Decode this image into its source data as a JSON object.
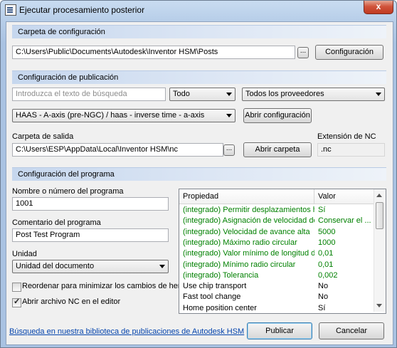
{
  "window": {
    "title": "Ejecutar procesamiento posterior",
    "close_glyph": "x"
  },
  "config_folder": {
    "header": "Carpeta de configuración",
    "path": "C:\\Users\\Public\\Documents\\Autodesk\\Inventor HSM\\Posts",
    "browse_label": "...",
    "button_label": "Configuración"
  },
  "publish_config": {
    "header": "Configuración de publicación",
    "search_placeholder": "Introduzca el texto de búsqueda",
    "filter_value": "Todo",
    "vendor_value": "Todos los proveedores",
    "post_value": "HAAS - A-axis (pre-NGC) / haas - inverse time - a-axis",
    "open_config_label": "Abrir configuración",
    "output_folder_label": "Carpeta de salida",
    "output_folder_path": "C:\\Users\\ESP\\AppData\\Local\\Inventor HSM\\nc",
    "output_browse_label": "...",
    "open_folder_label": "Abrir carpeta",
    "nc_ext_label": "Extensión de NC",
    "nc_ext_value": ".nc"
  },
  "program_config": {
    "header": "Configuración del programa",
    "program_name_label": "Nombre o número del programa",
    "program_name_value": "1001",
    "program_comment_label": "Comentario del programa",
    "program_comment_value": "Post Test Program",
    "unit_label": "Unidad",
    "unit_value": "Unidad del documento",
    "reorder_label": "Reordenar para minimizar los cambios de herrami",
    "reorder_checked": false,
    "open_nc_label": "Abrir archivo NC en el editor",
    "open_nc_checked": true
  },
  "properties": {
    "col_property": "Propiedad",
    "col_value": "Valor",
    "rows": [
      {
        "name": "(integrado) Permitir desplazamientos he...",
        "value": "Sí",
        "integrated": true
      },
      {
        "name": "(integrado) Asignación de velocidad de ...",
        "value": "Conservar el ...",
        "integrated": true
      },
      {
        "name": "(integrado) Velocidad de avance alta",
        "value": "5000",
        "integrated": true
      },
      {
        "name": "(integrado) Máximo radio circular",
        "value": "1000",
        "integrated": true
      },
      {
        "name": "(integrado) Valor mínimo de longitud de ...",
        "value": "0,01",
        "integrated": true
      },
      {
        "name": "(integrado) Mínimo radio circular",
        "value": "0,01",
        "integrated": true
      },
      {
        "name": "(integrado) Tolerancia",
        "value": "0,002",
        "integrated": true
      },
      {
        "name": "Use chip transport",
        "value": "No",
        "integrated": false
      },
      {
        "name": "Fast tool change",
        "value": "No",
        "integrated": false
      },
      {
        "name": "Home position center",
        "value": "Sí",
        "integrated": false
      }
    ]
  },
  "footer": {
    "library_link": "Búsqueda en nuestra biblioteca de publicaciones de Autodesk HSM",
    "post_button": "Publicar",
    "cancel_button": "Cancelar"
  },
  "colors": {
    "integrated_text": "#008000",
    "link": "#0645ad"
  }
}
